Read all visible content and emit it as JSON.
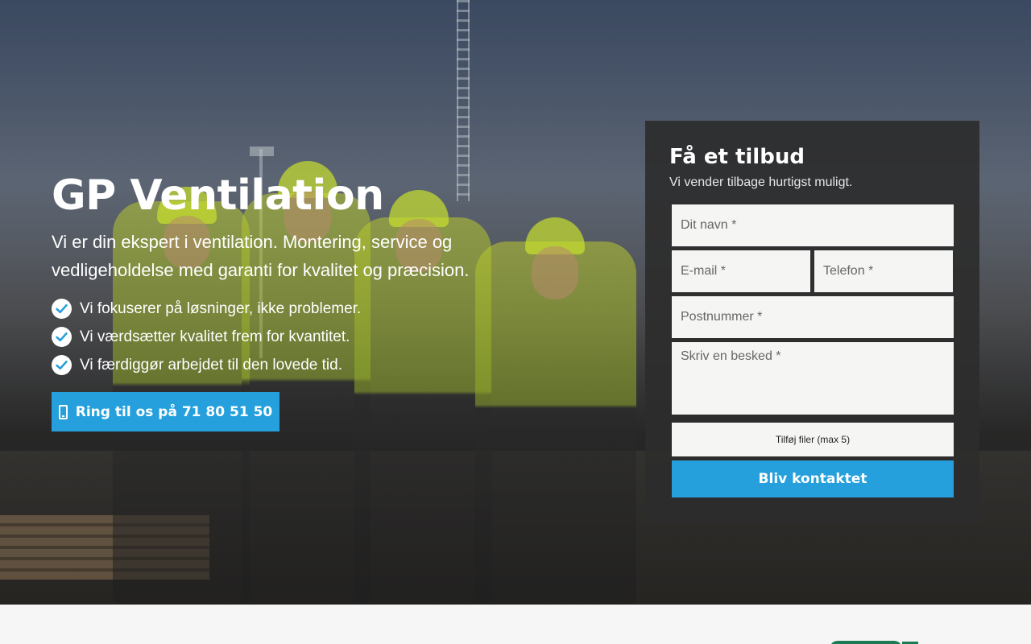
{
  "hero": {
    "title": "GP Ventilation",
    "subtitle": "Vi er din ekspert i ventilation. Montering, service og vedligeholdelse med garanti for kvalitet og præcision.",
    "features": [
      "Vi fokuserer på løsninger, ikke problemer.",
      "Vi værdsætter kvalitet frem for kvantitet.",
      "Vi færdiggør arbejdet til den lovede tid."
    ],
    "call_label": "Ring til os på 71 80 51 50"
  },
  "form": {
    "title": "Få et tilbud",
    "subtitle": "Vi vender tilbage hurtigst muligt.",
    "name_placeholder": "Dit navn *",
    "email_placeholder": "E-mail *",
    "phone_placeholder": "Telefon *",
    "zip_placeholder": "Postnummer *",
    "message_placeholder": "Skriv en besked *",
    "files_label": "Tilføj filer (max 5)",
    "submit_label": "Bliv kontaktet"
  },
  "colors": {
    "accent": "#25a0dc",
    "form_background": "#2d2d2d"
  },
  "icons": {
    "feature": "check-circle-icon",
    "call": "mobile-phone-icon"
  }
}
